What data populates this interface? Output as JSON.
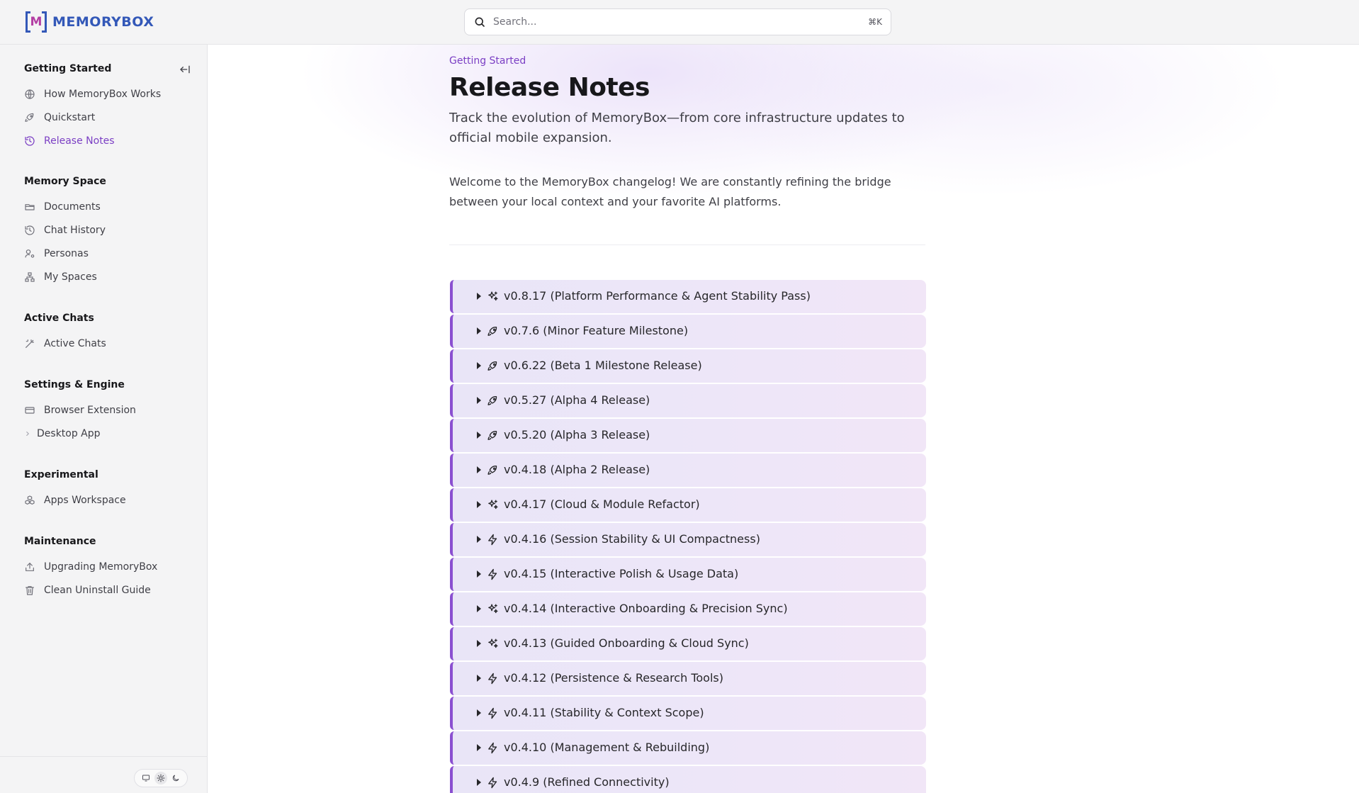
{
  "header": {
    "logo_text": "MEMORYBOX",
    "logo_mark": "M",
    "search_placeholder": "Search...",
    "search_shortcut": "⌘K"
  },
  "sidebar": {
    "sections": [
      {
        "title": "Getting Started",
        "items": [
          {
            "label": "How MemoryBox Works",
            "icon": "globe-icon"
          },
          {
            "label": "Quickstart",
            "icon": "rocket-icon"
          },
          {
            "label": "Release Notes",
            "icon": "history-icon",
            "active": true
          }
        ]
      },
      {
        "title": "Memory Space",
        "items": [
          {
            "label": "Documents",
            "icon": "folder-icon"
          },
          {
            "label": "Chat History",
            "icon": "history-icon"
          },
          {
            "label": "Personas",
            "icon": "user-cog-icon"
          },
          {
            "label": "My Spaces",
            "icon": "network-icon"
          }
        ]
      },
      {
        "title": "Active Chats",
        "items": [
          {
            "label": "Active Chats",
            "icon": "wand-icon"
          }
        ]
      },
      {
        "title": "Settings & Engine",
        "items": [
          {
            "label": "Browser Extension",
            "icon": "card-icon"
          },
          {
            "label": "Desktop App",
            "icon": "chevron-right-icon"
          }
        ]
      },
      {
        "title": "Experimental",
        "items": [
          {
            "label": "Apps Workspace",
            "icon": "boxes-icon"
          }
        ]
      },
      {
        "title": "Maintenance",
        "items": [
          {
            "label": "Upgrading MemoryBox",
            "icon": "upload-icon"
          },
          {
            "label": "Clean Uninstall Guide",
            "icon": "trash-icon"
          }
        ]
      }
    ],
    "theme": {
      "selected": "light",
      "options": [
        "system",
        "light",
        "dark"
      ]
    }
  },
  "main": {
    "breadcrumb": "Getting Started",
    "title": "Release Notes",
    "subtitle": "Track the evolution of MemoryBox—from core infrastructure updates to official mobile expansion.",
    "intro": "Welcome to the MemoryBox changelog! We are constantly refining the bridge between your local context and your favorite AI platforms.",
    "releases": [
      {
        "label": "v0.8.17 (Platform Performance & Agent Stability Pass)",
        "icon": "sparkles-icon"
      },
      {
        "label": "v0.7.6 (Minor Feature Milestone)",
        "icon": "rocket-icon"
      },
      {
        "label": "v0.6.22 (Beta 1 Milestone Release)",
        "icon": "rocket-icon"
      },
      {
        "label": "v0.5.27 (Alpha 4 Release)",
        "icon": "rocket-icon"
      },
      {
        "label": "v0.5.20 (Alpha 3 Release)",
        "icon": "rocket-icon"
      },
      {
        "label": "v0.4.18 (Alpha 2 Release)",
        "icon": "rocket-icon"
      },
      {
        "label": "v0.4.17 (Cloud & Module Refactor)",
        "icon": "sparkles-icon"
      },
      {
        "label": "v0.4.16 (Session Stability & UI Compactness)",
        "icon": "zap-icon"
      },
      {
        "label": "v0.4.15 (Interactive Polish & Usage Data)",
        "icon": "zap-icon"
      },
      {
        "label": "v0.4.14 (Interactive Onboarding & Precision Sync)",
        "icon": "sparkles-icon"
      },
      {
        "label": "v0.4.13 (Guided Onboarding & Cloud Sync)",
        "icon": "sparkles-icon"
      },
      {
        "label": "v0.4.12 (Persistence & Research Tools)",
        "icon": "zap-icon"
      },
      {
        "label": "v0.4.11 (Stability & Context Scope)",
        "icon": "zap-icon"
      },
      {
        "label": "v0.4.10 (Management & Rebuilding)",
        "icon": "zap-icon"
      },
      {
        "label": "v0.4.9 (Refined Connectivity)",
        "icon": "zap-icon"
      }
    ]
  },
  "colors": {
    "accent": "#7b3fc4",
    "brand": "#3358b8",
    "release_border": "#8a4fd0"
  }
}
